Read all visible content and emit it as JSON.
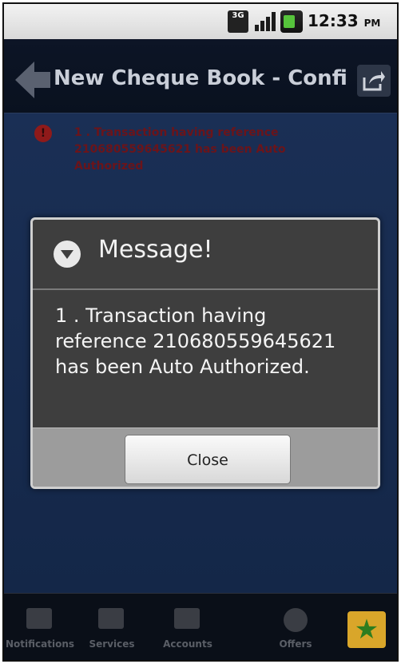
{
  "status_bar": {
    "network_badge": "3G",
    "time": "12:33",
    "ampm": "PM",
    "icons": [
      "network-3g-icon",
      "signal-icon",
      "battery-icon"
    ]
  },
  "title_bar": {
    "title": "New Cheque Book - Confirm",
    "back_icon": "back-arrow-icon",
    "share_icon": "share-icon"
  },
  "content": {
    "error_message": "1 . Transaction having reference 210680559645621 has been Auto Authorized"
  },
  "dialog": {
    "title": "Message!",
    "body": "1 . Transaction having reference 210680559645621 has been Auto Authorized.",
    "close_label": "Close"
  },
  "bottom_nav": {
    "items": [
      {
        "label": "Notifications",
        "icon": "notifications-icon"
      },
      {
        "label": "Services",
        "icon": "services-icon"
      },
      {
        "label": "Accounts",
        "icon": "accounts-icon"
      },
      {
        "label": "Offers",
        "icon": "offers-icon"
      }
    ],
    "star_icon": "star-icon"
  },
  "colors": {
    "background": "#142748",
    "dialog": "#3e3e3e",
    "error_text": "#7a1010",
    "star": "#2e7d1f"
  }
}
